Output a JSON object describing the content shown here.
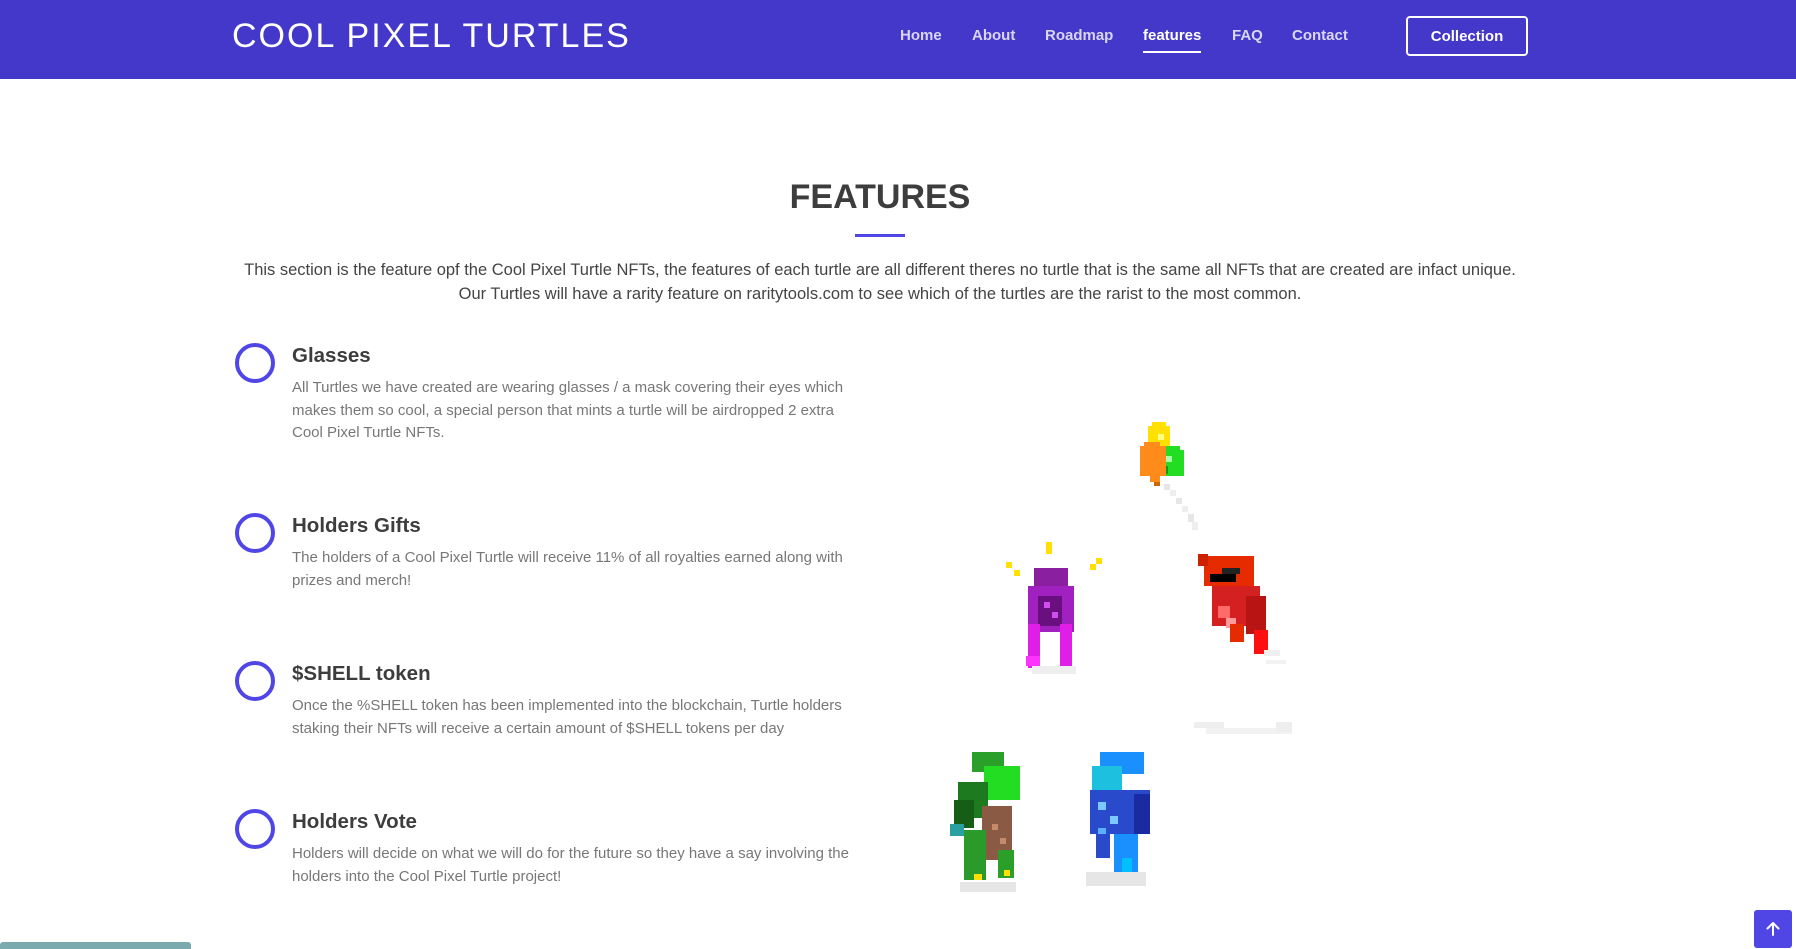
{
  "header": {
    "logo": "COOL PIXEL TURTLES",
    "nav": [
      "Home",
      "About",
      "Roadmap",
      "features",
      "FAQ",
      "Contact"
    ],
    "active_nav": "features",
    "collection_button": "Collection"
  },
  "features_section": {
    "title": "FEATURES",
    "intro": "This section is the feature opf the Cool Pixel Turtle NFTs, the features of each turtle are all different theres no turtle that is the same all NFTs that are created are infact unique. Our Turtles will have a rarity feature on raritytools.com to see which of the turtles are the rarist to the most common.",
    "items": [
      {
        "title": "Glasses",
        "description": "All Turtles we have created are wearing glasses / a mask covering their eyes which makes them so cool, a special person that mints a turtle will be airdropped 2 extra Cool Pixel Turtle NFTs."
      },
      {
        "title": "Holders Gifts",
        "description": "The holders of a Cool Pixel Turtle will receive 11% of all royalties earned along with prizes and merch!"
      },
      {
        "title": "$SHELL token",
        "description": "Once the %SHELL token has been implemented into the blockchain, Turtle holders staking their NFTs will receive a certain amount of $SHELL tokens per day"
      },
      {
        "title": "Holders Vote",
        "description": "Holders will decide on what we will do for the future so they have a say involving the holders into the Cool Pixel Turtle project!"
      }
    ]
  },
  "colors": {
    "header_bg": "#4338ca",
    "accent": "#4f46e5",
    "heading": "#3d3d3d",
    "body_text": "#777777"
  },
  "icons": {
    "back_to_top": "arrow-up-icon",
    "feature_marker": "circle-ring-icon"
  }
}
